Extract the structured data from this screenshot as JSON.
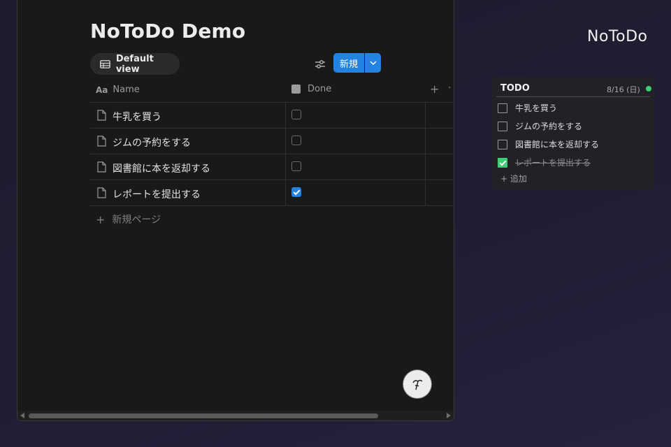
{
  "notion": {
    "page_title": "NoToDo Demo",
    "view_tab_label": "Default view",
    "new_button_label": "新規",
    "columns": {
      "name": "Name",
      "name_icon": "Aa",
      "done": "Done"
    },
    "rows": [
      {
        "name": "牛乳を買う",
        "done": false
      },
      {
        "name": "ジムの予約をする",
        "done": false
      },
      {
        "name": "図書館に本を返却する",
        "done": false
      },
      {
        "name": "レポートを提出する",
        "done": true
      }
    ],
    "add_page_label": "新規ページ"
  },
  "widget": {
    "app_name": "NoToDo",
    "title": "TODO",
    "date": "8/16 (日)",
    "items": [
      {
        "label": "牛乳を買う",
        "done": false
      },
      {
        "label": "ジムの予約をする",
        "done": false
      },
      {
        "label": "図書館に本を返却する",
        "done": false
      },
      {
        "label": "レポートを提出する",
        "done": true
      }
    ],
    "add_label": "+ 追加",
    "status_color": "#3ecf75"
  },
  "colors": {
    "accent": "#2383e2",
    "done_green": "#3ecf75"
  },
  "icons": [
    "table-icon",
    "filter-sliders-icon",
    "chevron-down-icon",
    "page-icon",
    "checkbox-icon",
    "plus-icon",
    "help-face-icon"
  ]
}
